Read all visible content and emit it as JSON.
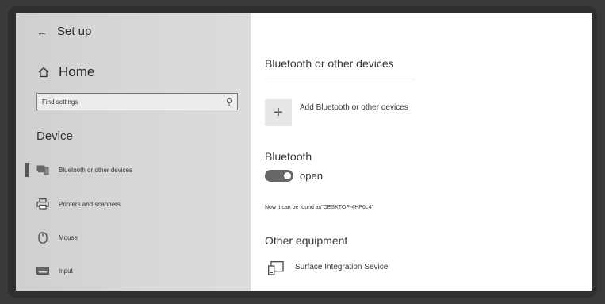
{
  "sidebar": {
    "back_label": "Set up",
    "home_label": "Home",
    "search_placeholder": "Find settings",
    "section_title": "Device",
    "items": [
      {
        "label": "Bluetooth or other devices",
        "icon": "devices-icon",
        "active": true
      },
      {
        "label": "Printers and scanners",
        "icon": "printer-icon"
      },
      {
        "label": "Mouse",
        "icon": "mouse-icon"
      },
      {
        "label": "Input",
        "icon": "keyboard-icon"
      }
    ]
  },
  "main": {
    "title": "Bluetooth or other devices",
    "add_label": "Add Bluetooth or other devices",
    "bluetooth_heading": "Bluetooth",
    "toggle_label": "open",
    "discoverable_text": "Now it can be found as\"DESKTOP-4HP6L4\"",
    "other_heading": "Other equipment",
    "devices": [
      {
        "name": "Surface Integration Sevice",
        "icon": "tablet-icon"
      }
    ]
  },
  "colors": {
    "sidebar_bg": "#d6d6d6",
    "toggle_on": "#666666",
    "frame": "#2f2f2f"
  }
}
